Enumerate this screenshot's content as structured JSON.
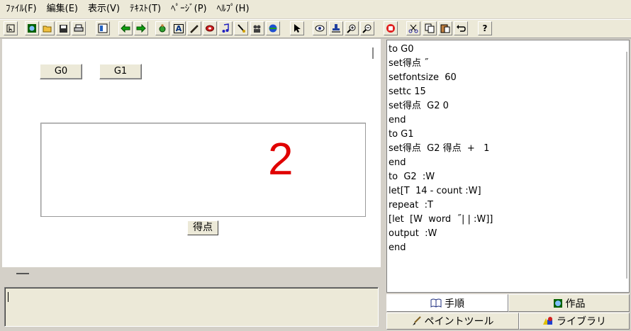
{
  "menu": [
    "ﾌｧｲﾙ(F)",
    "編集(E)",
    "表示(V)",
    "ﾃｷｽﾄ(T)",
    "ﾍﾟｰｼﾞ(P)",
    "ﾍﾙﾌﾟ(H)"
  ],
  "toolbar": {
    "text_tool_glyph": "A",
    "help_glyph": "?"
  },
  "canvas": {
    "button_g0": "G0",
    "button_g1": "G1",
    "score_value": "2",
    "score_label": "得点"
  },
  "editor": {
    "lines": [
      "to G0",
      "set得点 ˝",
      "setfontsize  60",
      "settc 15",
      "set得点  G2 0",
      "end",
      "to G1",
      "set得点  G2 得点  +   1",
      "end",
      "to  G2  :W",
      "let[T  14 - count :W]",
      "repeat  :T",
      "[let  [W  word  ˝| | :W]]",
      "output  :W",
      "end"
    ]
  },
  "tabs": {
    "procedures": "手順",
    "works": "作品",
    "paint_tool": "ペイントツール",
    "library": "ライブラリ"
  }
}
